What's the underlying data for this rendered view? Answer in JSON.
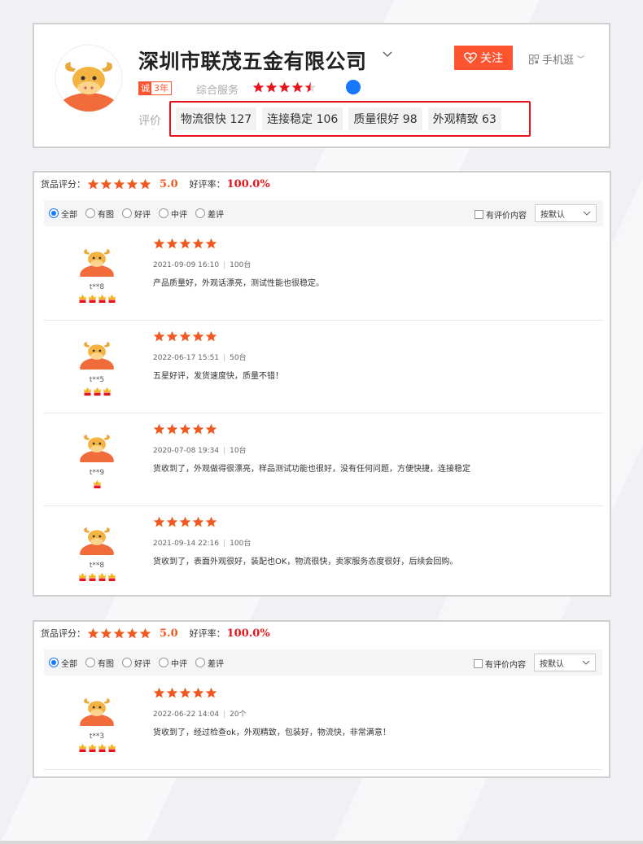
{
  "colors": {
    "accent_orange": "#f2581f",
    "rate_red": "#e8141c",
    "follow_bg": "#fc5431",
    "radio_blue": "#1677ff"
  },
  "shop": {
    "name": "深圳市联茂五金有限公司",
    "follow_label": "关注",
    "follow_icon": "heart-plus-icon",
    "mobile_label": "手机逛",
    "years_badge_left": "诚",
    "years_badge_right": "3年",
    "service_label": "综合服务",
    "service_rating": 4.5,
    "eval_label": "评价",
    "tags": [
      {
        "text": "物流很快 127"
      },
      {
        "text": "连接稳定 106"
      },
      {
        "text": "质量很好 98"
      },
      {
        "text": "外观精致 63"
      }
    ]
  },
  "panel1": {
    "score_label": "货品评分：",
    "score": "5.0",
    "rate_label": "好评率：",
    "rate": "100.0%",
    "filters": [
      {
        "label": "全部",
        "checked": true
      },
      {
        "label": "有图",
        "checked": false
      },
      {
        "label": "好评",
        "checked": false
      },
      {
        "label": "中评",
        "checked": false
      },
      {
        "label": "差评",
        "checked": false
      }
    ],
    "content_filter_label": "有评价内容",
    "sort_label": "按默认",
    "reviews": [
      {
        "user": "t**8",
        "stars": 5,
        "badges": 4,
        "date": "2021-09-09 16:10",
        "qty": "100台",
        "text": "产品质量好，外观话漂亮，测试性能也很稳定。"
      },
      {
        "user": "t**5",
        "stars": 5,
        "badges": 3,
        "date": "2022-06-17 15:51",
        "qty": "50台",
        "text": "五星好评，发货速度快，质量不错！"
      },
      {
        "user": "t**9",
        "stars": 5,
        "badges": 1,
        "date": "2020-07-08 19:34",
        "qty": "10台",
        "text": "货收到了，外观做得很漂亮，样品测试功能也很好，没有任何问题，方便快捷，连接稳定"
      },
      {
        "user": "t**8",
        "stars": 5,
        "badges": 4,
        "date": "2021-09-14 22:16",
        "qty": "100台",
        "text": "货收到了，表面外观很好，装配也OK，物流很快，卖家服务态度很好，后续会回购。"
      }
    ]
  },
  "panel2": {
    "score_label": "货品评分：",
    "score": "5.0",
    "rate_label": "好评率：",
    "rate": "100.0%",
    "filters": [
      {
        "label": "全部",
        "checked": true
      },
      {
        "label": "有图",
        "checked": false
      },
      {
        "label": "好评",
        "checked": false
      },
      {
        "label": "中评",
        "checked": false
      },
      {
        "label": "差评",
        "checked": false
      }
    ],
    "content_filter_label": "有评价内容",
    "sort_label": "按默认",
    "reviews": [
      {
        "user": "t**3",
        "stars": 5,
        "badges": 4,
        "date": "2022-06-22 14:04",
        "qty": "20个",
        "text": "货收到了，经过检查ok，外观精致，包装好，物流快，非常满意！"
      }
    ]
  }
}
